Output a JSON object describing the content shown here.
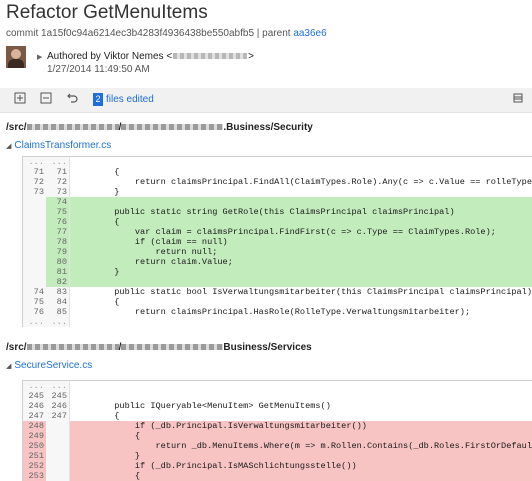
{
  "header": {
    "title": "Refactor GetMenuItems",
    "commit_prefix": "commit",
    "commit_hash": "1a15f0c94a6214ec3b4283f4936438be550abfb5",
    "parent_sep": "| parent",
    "parent_hash": "aa36e6",
    "author_label": "Authored by Viktor Nemes <",
    "author_suffix": ">",
    "date": "1/27/2014 11:49:50 AM"
  },
  "toolbar": {
    "files_count": "2",
    "files_label": "files edited"
  },
  "files": [
    {
      "path_prefix": "/src/",
      "path_mid": "/",
      "path_suffix": ".Business/Security",
      "name": "ClaimsTransformer.cs"
    },
    {
      "path_prefix": "/src/",
      "path_mid": "/",
      "path_suffix": "Business/Services",
      "name": "SecureService.cs"
    }
  ],
  "diff1": [
    {
      "t": "dots",
      "a": "...",
      "b": "...",
      "c": ""
    },
    {
      "t": "ctx",
      "a": "71",
      "b": "71",
      "c": "        {"
    },
    {
      "t": "ctx",
      "a": "72",
      "b": "72",
      "c": "            return claimsPrincipal.FindAll(ClaimTypes.Role).Any(c => c.Value == rolleType);"
    },
    {
      "t": "ctx",
      "a": "73",
      "b": "73",
      "c": "        }"
    },
    {
      "t": "add",
      "a": "",
      "b": "74",
      "c": ""
    },
    {
      "t": "add",
      "a": "",
      "b": "75",
      "c": "        public static string GetRole(this ClaimsPrincipal claimsPrincipal)"
    },
    {
      "t": "add",
      "a": "",
      "b": "76",
      "c": "        {"
    },
    {
      "t": "add",
      "a": "",
      "b": "77",
      "c": "            var claim = claimsPrincipal.FindFirst(c => c.Type == ClaimTypes.Role);"
    },
    {
      "t": "add",
      "a": "",
      "b": "78",
      "c": "            if (claim == null)"
    },
    {
      "t": "add",
      "a": "",
      "b": "79",
      "c": "                return null;"
    },
    {
      "t": "add",
      "a": "",
      "b": "80",
      "c": "            return claim.Value;"
    },
    {
      "t": "add",
      "a": "",
      "b": "81",
      "c": "        }"
    },
    {
      "t": "add",
      "a": "",
      "b": "82",
      "c": ""
    },
    {
      "t": "ctx",
      "a": "74",
      "b": "83",
      "c": "        public static bool IsVerwaltungsmitarbeiter(this ClaimsPrincipal claimsPrincipal)"
    },
    {
      "t": "ctx",
      "a": "75",
      "b": "84",
      "c": "        {"
    },
    {
      "t": "ctx",
      "a": "76",
      "b": "85",
      "c": "            return claimsPrincipal.HasRole(RolleType.Verwaltungsmitarbeiter);"
    },
    {
      "t": "dots",
      "a": "...",
      "b": "...",
      "c": ""
    }
  ],
  "diff2": [
    {
      "t": "dots",
      "a": "...",
      "b": "...",
      "c": ""
    },
    {
      "t": "ctx",
      "a": "245",
      "b": "245",
      "c": ""
    },
    {
      "t": "ctx",
      "a": "246",
      "b": "246",
      "c": "        public IQueryable<MenuItem> GetMenuItems()"
    },
    {
      "t": "ctx",
      "a": "247",
      "b": "247",
      "c": "        {"
    },
    {
      "t": "del",
      "a": "248",
      "b": "",
      "c": "            if (_db.Principal.IsVerwaltungsmitarbeiter())"
    },
    {
      "t": "del",
      "a": "249",
      "b": "",
      "c": "            {"
    },
    {
      "t": "del",
      "a": "250",
      "b": "",
      "c": "                return _db.MenuItems.Where(m => m.Rollen.Contains(_db.Roles.FirstOrDefault("
    },
    {
      "t": "del",
      "a": "251",
      "b": "",
      "c": "            }"
    },
    {
      "t": "del",
      "a": "252",
      "b": "",
      "c": "            if (_db.Principal.IsMASchlichtungsstelle())"
    },
    {
      "t": "del",
      "a": "253",
      "b": "",
      "c": "            {"
    }
  ]
}
